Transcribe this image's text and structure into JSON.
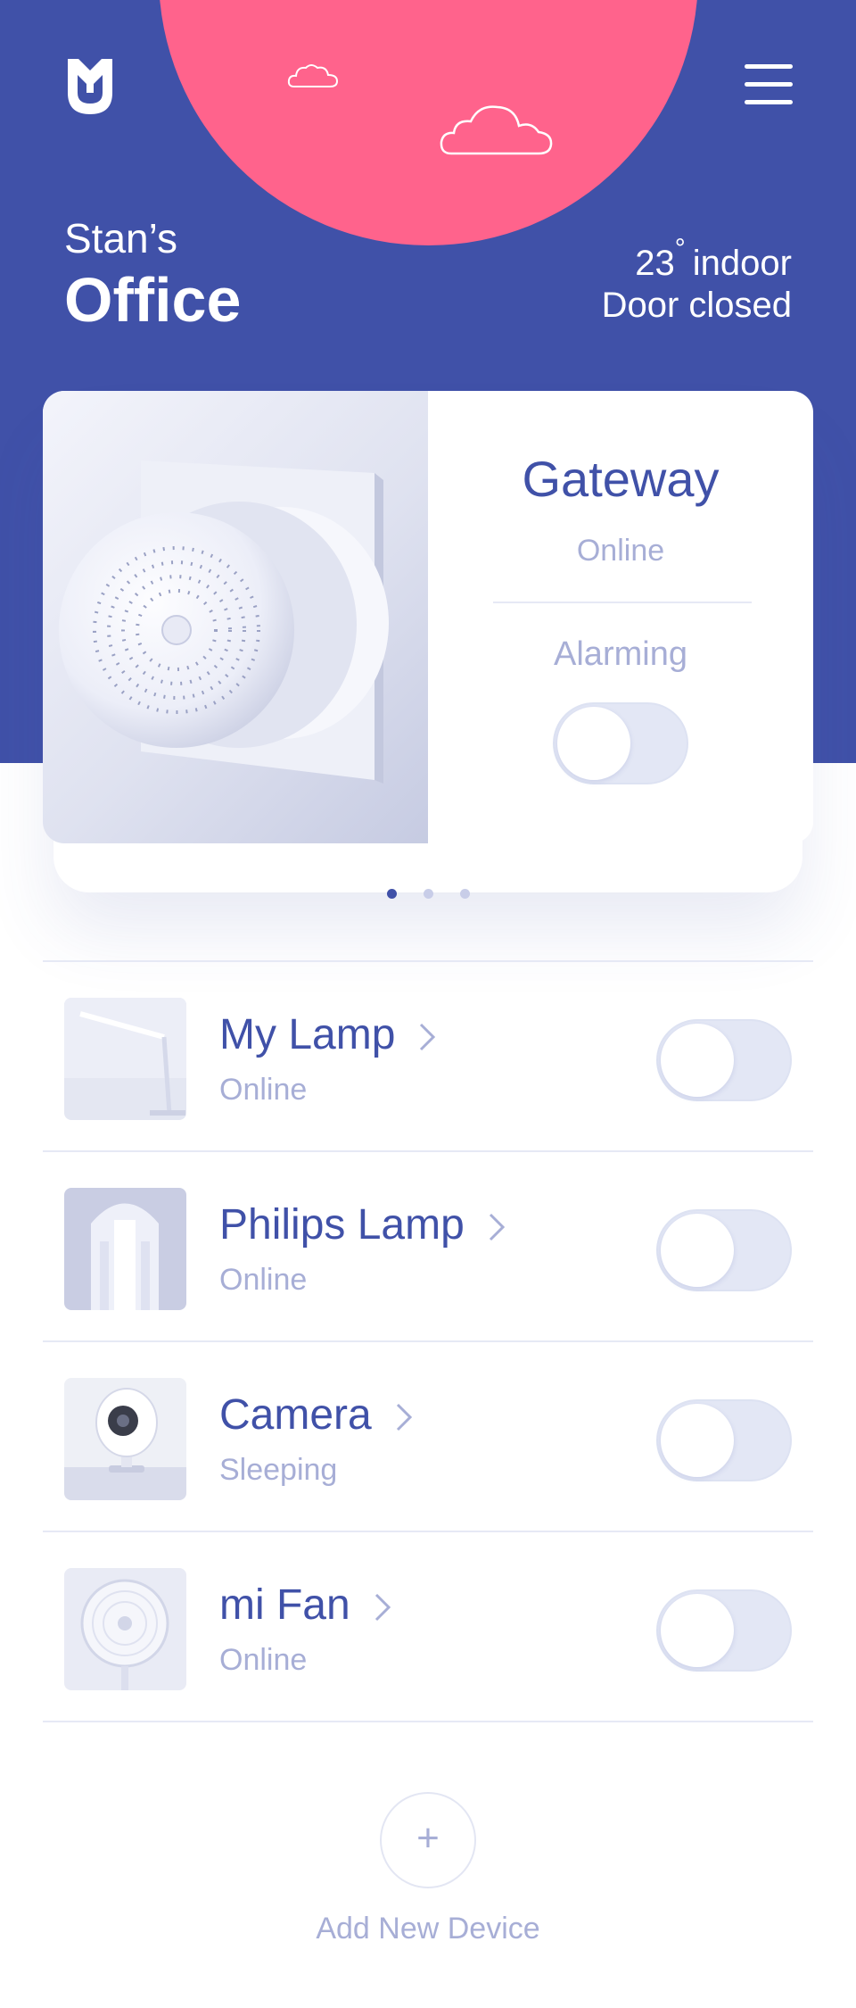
{
  "header": {
    "room_owner": "Stan’s",
    "room_name": "Office",
    "temperature": "23",
    "degree_symbol": "°",
    "temp_label": "indoor",
    "door_status": "Door closed",
    "background_color": "#4051a8",
    "sun_color": "#ff638c"
  },
  "gateway": {
    "title": "Gateway",
    "status": "Online",
    "alarm_label": "Alarming",
    "alarm_on": false
  },
  "carousel": {
    "pages": 3,
    "active": 1
  },
  "devices": [
    {
      "name": "My Lamp",
      "status": "Online",
      "on": false,
      "icon": "desk-lamp-photo"
    },
    {
      "name": "Philips Lamp",
      "status": "Online",
      "on": false,
      "icon": "philips-lamp-photo"
    },
    {
      "name": "Camera",
      "status": "Sleeping",
      "on": false,
      "icon": "camera-photo"
    },
    {
      "name": "mi Fan",
      "status": "Online",
      "on": false,
      "icon": "fan-photo"
    }
  ],
  "add_device": {
    "icon": "+",
    "label": "Add New Device"
  }
}
